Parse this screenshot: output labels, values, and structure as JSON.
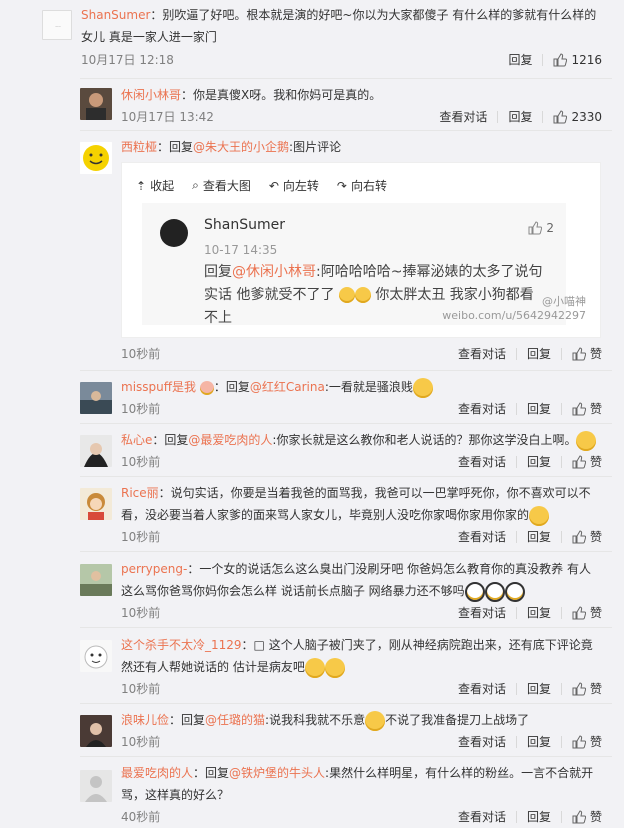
{
  "comments": [
    {
      "user": "ShanSumer",
      "text": "：别吹逼了好吧。根本就是演的好吧~你以为大家都傻子 有什么样的爹就有什么样的女儿 真是一家人进一家门",
      "time": "10月17日 12:18",
      "reply": "回复",
      "likes": "1216"
    },
    {
      "user": "休闲小林哥",
      "text": "：你是真傻X呀。我和你妈可是真的。",
      "time": "10月17日 13:42",
      "view": "查看对话",
      "reply": "回复",
      "likes": "2330"
    },
    {
      "user": "西粒桠",
      "pre": "：回复",
      "at": "@朱大王的小企鹅",
      "post": ":图片评论",
      "time": "10秒前",
      "view": "查看对话",
      "reply": "回复",
      "likes": "赞"
    },
    {
      "user": "misspuff是我",
      "pre": "：回复",
      "at": "@红红Carina",
      "post": ":一看就是骚浪贱",
      "time": "10秒前",
      "view": "查看对话",
      "reply": "回复",
      "likes": "赞"
    },
    {
      "user": "私心e",
      "pre": "：回复",
      "at": "@最爱吃肉的人",
      "post": ":你家长就是这么教你和老人说话的？那你这学没白上啊。",
      "time": "10秒前",
      "view": "查看对话",
      "reply": "回复",
      "likes": "赞"
    },
    {
      "user": "Rice丽",
      "text": "：说句实话，你要是当着我爸的面骂我，我爸可以一巴掌呼死你，你不喜欢可以不看，没必要当着人家爹的面来骂人家女儿，毕竟别人没吃你家喝你家用你家的",
      "time": "10秒前",
      "view": "查看对话",
      "reply": "回复",
      "likes": "赞"
    },
    {
      "user": "perrypeng-",
      "text": "：一个女的说话怎么这么臭出门没刷牙吧 你爸妈怎么教育你的真没教养 有人这么骂你爸骂你妈你会怎么样 说话前长点脑子 网络暴力还不够吗",
      "time": "10秒前",
      "view": "查看对话",
      "reply": "回复",
      "likes": "赞"
    },
    {
      "user": "这个杀手不太冷_1129",
      "text": "：□ 这个人脑子被门夹了，刚从神经病院跑出来，还有底下评论竟然还有人帮她说话的 估计是病友吧",
      "time": "10秒前",
      "view": "查看对话",
      "reply": "回复",
      "likes": "赞"
    },
    {
      "user": "浪味儿俭",
      "pre": "：回复",
      "at": "@任璐的猫",
      "post": ":说我科我就不乐意",
      "post2": "不说了我准备提刀上战场了",
      "time": "10秒前",
      "view": "查看对话",
      "reply": "回复",
      "likes": "赞"
    },
    {
      "user": "最爱吃肉的人",
      "pre": "：回复",
      "at": "@铁炉堡的牛头人",
      "post": ":果然什么样明星，有什么样的粉丝。一言不合就开骂，这样真的好么？",
      "time": "40秒前",
      "view": "查看对话",
      "reply": "回复",
      "likes": "赞"
    }
  ],
  "pic": {
    "toolbar": [
      "收起",
      "查看大图",
      "向左转",
      "向右转"
    ],
    "name": "ShanSumer",
    "time": "10-17 14:35",
    "likes": "2",
    "reply_pre": "回复",
    "reply_at": "@休闲小林哥",
    "reply_text1": ":阿哈哈哈哈~捧幂泌婊的太多了说句实话 他爹就受不了了",
    "reply_text2": "你太胖太丑 我家小狗都看不上",
    "watermark1": "@小喵神",
    "watermark2": "weibo.com/u/5642942297"
  },
  "colors": {
    "username": "#eb7350",
    "muted": "#808080"
  }
}
